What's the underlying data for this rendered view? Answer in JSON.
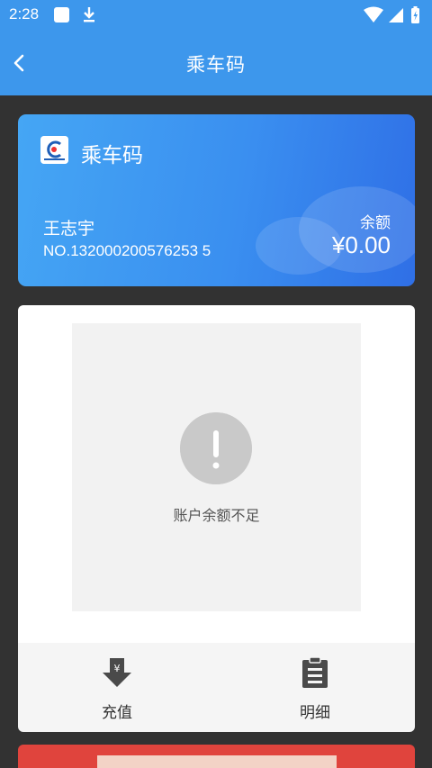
{
  "status_bar": {
    "time": "2:28",
    "icons": [
      "notification-square-icon",
      "download-icon",
      "wifi-icon",
      "signal-icon",
      "battery-charging-icon"
    ]
  },
  "app_bar": {
    "back_icon": "chevron-left-icon",
    "title": "乘车码"
  },
  "card": {
    "logo_icon": "transit-logo-icon",
    "title": "乘车码",
    "holder_name": "王志宇",
    "card_number": "NO.132000200576253 5",
    "balance_label": "余额",
    "balance_value": "¥0.00",
    "gradient_colors": [
      "#45a6f4",
      "#2f6fe6"
    ]
  },
  "qr_area": {
    "warning_icon": "exclamation-icon",
    "message": "账户余额不足"
  },
  "actions": [
    {
      "icon": "recharge-download-icon",
      "label": "充值"
    },
    {
      "icon": "clipboard-list-icon",
      "label": "明细"
    }
  ],
  "colors": {
    "primary": "#3d97ec",
    "background": "#323232",
    "banner": "#e0443d"
  }
}
